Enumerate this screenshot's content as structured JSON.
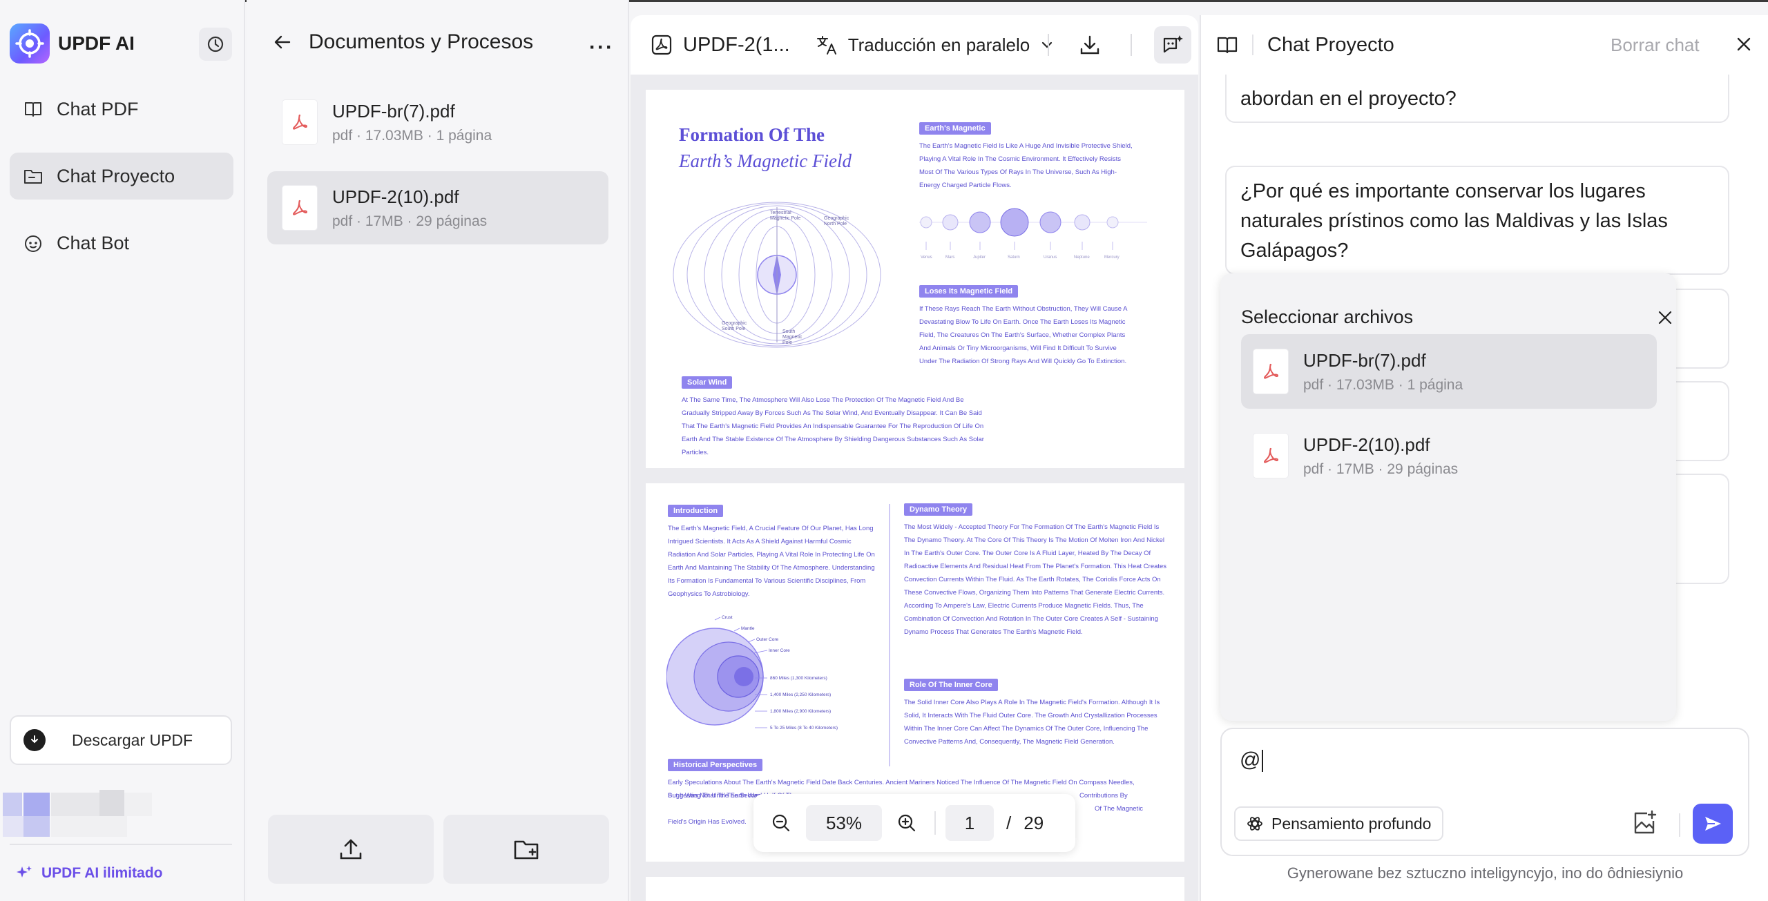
{
  "app": {
    "title": "UPDF AI"
  },
  "sidebar": {
    "items": [
      {
        "label": "Chat PDF",
        "icon": "book-icon"
      },
      {
        "label": "Chat Proyecto",
        "icon": "folder-chat-icon",
        "active": true
      },
      {
        "label": "Chat Bot",
        "icon": "bot-icon"
      }
    ],
    "download_label": "Descargar UPDF",
    "unlimited_label": "UPDF AI ilimitado"
  },
  "docs": {
    "title": "Documentos y Procesos",
    "files": [
      {
        "name": "UPDF-br(7).pdf",
        "meta": "pdf · 17.03MB · 1 página"
      },
      {
        "name": "UPDF-2(10).pdf",
        "meta": "pdf · 17MB · 29 páginas",
        "active": true
      }
    ]
  },
  "viewer": {
    "title": "UPDF-2(1...",
    "translate_label": "Traducción en paralelo",
    "zoom": "53%",
    "page_current": "1",
    "page_sep": "/",
    "page_total": "29",
    "page1": {
      "title_line1": "Formation Of The",
      "title_line2": "Earth’s Magnetic Field",
      "tag_earth": "Earth's Magnetic",
      "text_earth": "The Earth's Magnetic Field Is Like A Huge And Invisible Protective Shield, Playing A Vital Role In The Cosmic Environment. It Effectively Resists Most Of The Various Types Of Rays In The Universe, Such As High-Energy Charged Particle Flows.",
      "planets": [
        "Venus",
        "Mars",
        "Jupiter",
        "Saturn",
        "Uranus",
        "Neptune",
        "Mercury"
      ],
      "tag_loses": "Loses Its Magnetic Field",
      "text_loses": "If These Rays Reach The Earth Without Obstruction, They Will Cause A Devastating Blow To Life On Earth. Once The Earth Loses Its Magnetic Field, The Creatures On The Earth's Surface, Whether Complex Plants And Animals Or Tiny Microorganisms, Will Find It Difficult To Survive Under The Radiation Of Strong Rays And Will Quickly Go To Extinction.",
      "tag_solar": "Solar Wind",
      "text_solar": "At The Same Time, The Atmosphere Will Also Lose The Protection Of The Magnetic Field And Be Gradually Stripped Away By Forces Such As The Solar Wind, And Eventually Disappear. It Can Be Said That The Earth's Magnetic Field Provides An Indispensable Guarantee For The Reproduction Of Life On Earth And The Stable Existence Of The Atmosphere By Shielding Dangerous Substances Such As Solar Particles.",
      "labels": [
        "Terrestrial Magnetic Pole",
        "Geographic North Pole",
        "Geographic South Pole",
        "South Magnetic Pole"
      ]
    },
    "page2": {
      "tag_intro": "Introduction",
      "text_intro": "The Earth's Magnetic Field, A Crucial Feature Of Our Planet, Has Long Intrigued Scientists. It Acts As A Shield Against Harmful Cosmic Radiation And Solar Particles, Playing A Vital Role In Protecting Life On Earth And Maintaining The Stability Of The Atmosphere. Understanding Its Formation Is Fundamental To Various Scientific Disciplines, From Geophysics To Astrobiology.",
      "tag_dynamo": "Dynamo Theory",
      "text_dynamo": "The Most Widely - Accepted Theory For The Formation Of The Earth's Magnetic Field Is The Dynamo Theory. At The Core Of This Theory Is The Motion Of Molten Iron And Nickel In The Earth's Outer Core. The Outer Core Is A Fluid Layer, Heated By The Decay Of Radioactive Elements And Residual Heat From The Planet's Formation. This Heat Creates Convection Currents Within The Fluid. As The Earth Rotates, The Coriolis Force Acts On These Convective Flows, Organizing Them Into Patterns That Generate Electric Currents. According To Ampere's Law, Electric Currents Produce Magnetic Fields. Thus, The Combination Of Convection And Rotation In The Outer Core Creates A Self - Sustaining Dynamo Process That Generates The Earth's Magnetic Field.",
      "tag_inner": "Role Of The Inner Core",
      "text_inner": "The Solid Inner Core Also Plays A Role In The Magnetic Field's Formation. Although It Is Solid, It Interacts With The Fluid Outer Core. The Growth And Crystallization Processes Within The Inner Core Can Affect The Dynamics Of The Outer Core, Influencing The Convective Patterns And, Consequently, The Magnetic Field Generation.",
      "tag_hist": "Historical Perspectives",
      "text_hist_a": "Early Speculations About The Earth's Magnetic Field Date Back Centuries. Ancient Mariners Noticed The Influence Of The Magnetic Field On Compass Needles, But It Was Not Until The Second Half Of The",
      "text_hist_b": "Contributions By",
      "text_hist_c": "Suggesting That The Earth Was",
      "text_hist_d": "Of The Magnetic",
      "text_hist_e": "Field's Origin Has Evolved.",
      "core_labels": [
        "Crust",
        "Mantle",
        "Outer Core",
        "Inner Core"
      ],
      "core_depths": [
        "860 Miles (1,300 Kilometers)",
        "1,400 Miles (2,250 Kilometers)",
        "1,800 Miles (2,900 Kilometers)",
        "5 To 25 Miles (8 To 40 Kilometers)"
      ]
    }
  },
  "chat": {
    "title": "Chat Proyecto",
    "clear_label": "Borrar chat",
    "bubble1": "abordan en el proyecto?",
    "bubble2": "¿Por qué es importante conservar los lugares naturales prístinos como las Maldivas y las Islas Galápagos?",
    "modal_title": "Seleccionar archivos",
    "modal_files": [
      {
        "name": "UPDF-br(7).pdf",
        "meta": "pdf · 17.03MB · 1 página",
        "active": true
      },
      {
        "name": "UPDF-2(10).pdf",
        "meta": "pdf · 17MB · 29 páginas"
      }
    ],
    "input_value": "@",
    "deep_think_label": "Pensamiento profundo",
    "disclaimer": "Gynerowane bez sztuczno inteligyncyjo, ino do ôdniesiynio"
  },
  "colors": {
    "accent": "#5b61f6",
    "pdf_red": "#e35a5a",
    "doc_purple": "#5c4fd6",
    "tag_purple": "#8f84ee"
  }
}
